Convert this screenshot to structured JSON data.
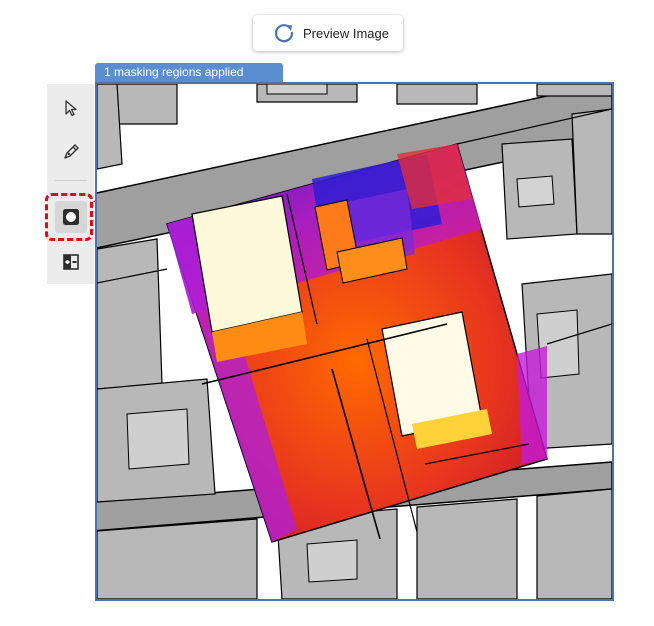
{
  "preview_button": {
    "label": "Preview Image",
    "icon": "refresh-icon"
  },
  "status": {
    "text": "1 masking regions applied"
  },
  "toolbar": {
    "tools": [
      {
        "name": "select-tool",
        "icon": "cursor-arrow-icon"
      },
      {
        "name": "pen-tool",
        "icon": "pen-icon"
      },
      {
        "name": "mask-tool",
        "icon": "mask-icon",
        "active": true
      },
      {
        "name": "compare-tool",
        "icon": "split-compare-icon"
      }
    ]
  },
  "colors": {
    "accent": "#5a8ed0",
    "highlight": "#e10d0d",
    "frame": "#4a74b0"
  }
}
